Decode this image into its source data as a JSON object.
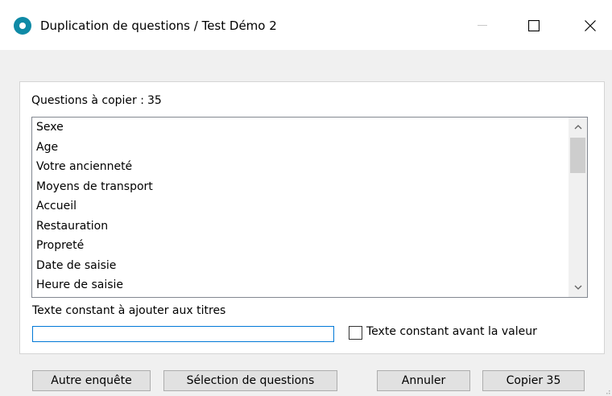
{
  "window": {
    "title": "Duplication de questions / Test Démo 2",
    "accent_color": "#0f8aa6",
    "controls": {
      "minimize": "minimize-icon",
      "maximize": "maximize-icon",
      "close": "close-icon"
    }
  },
  "questions": {
    "count_label": "Questions à copier :",
    "count_value": "35",
    "items": [
      "Sexe",
      "Age",
      "Votre ancienneté",
      "Moyens de transport",
      "Accueil",
      "Restauration",
      "Propreté",
      "Date de saisie",
      "Heure de saisie"
    ]
  },
  "constant_text": {
    "label": "Texte constant à ajouter aux titres",
    "value": "",
    "checkbox_label": "Texte constant avant la valeur",
    "checkbox_checked": false
  },
  "buttons": {
    "other_survey": "Autre enquête",
    "select_questions": "Sélection de questions",
    "cancel": "Annuler",
    "copy": "Copier 35"
  }
}
